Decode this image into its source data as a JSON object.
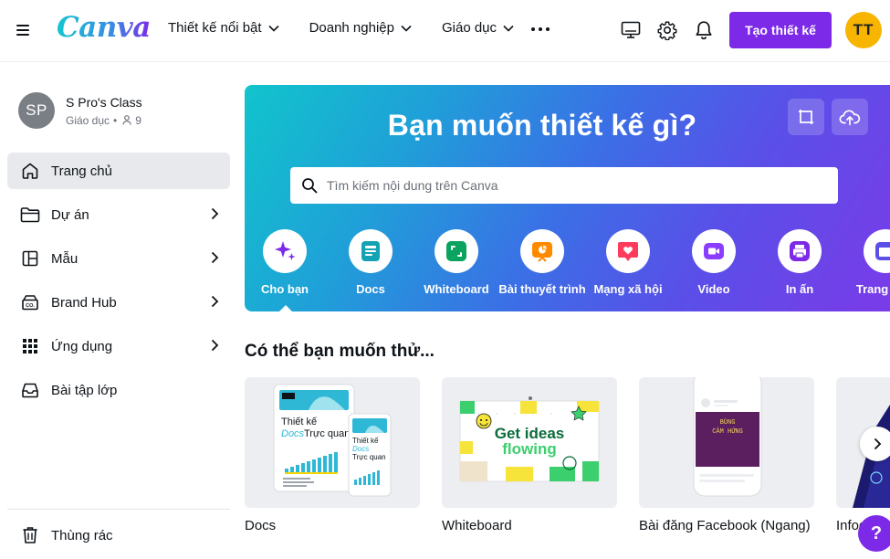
{
  "header": {
    "logo": "Canva",
    "nav": [
      {
        "label": "Thiết kế nổi bật"
      },
      {
        "label": "Doanh nghiệp"
      },
      {
        "label": "Giáo dục"
      }
    ],
    "create_button": "Tạo thiết kế",
    "user_initials": "TT"
  },
  "sidebar": {
    "team_initials": "SP",
    "team_name": "S Pro's Class",
    "team_type": "Giáo dục",
    "team_members": "9",
    "items": [
      {
        "label": "Trang chủ",
        "icon": "home-icon"
      },
      {
        "label": "Dự án",
        "icon": "folder-icon"
      },
      {
        "label": "Mẫu",
        "icon": "template-icon"
      },
      {
        "label": "Brand Hub",
        "icon": "brand-hub-icon"
      },
      {
        "label": "Ứng dụng",
        "icon": "apps-grid-icon"
      },
      {
        "label": "Bài tập lớp",
        "icon": "inbox-icon"
      }
    ],
    "trash": "Thùng rác"
  },
  "hero": {
    "title": "Bạn muốn thiết kế gì?",
    "search_placeholder": "Tìm kiếm nội dung trên Canva",
    "categories": [
      {
        "label": "Cho bạn",
        "color": "#7d2ae8"
      },
      {
        "label": "Docs",
        "color": "#13a3b5"
      },
      {
        "label": "Whiteboard",
        "color": "#0ba360"
      },
      {
        "label": "Bài thuyết trình",
        "color": "#ff8a00"
      },
      {
        "label": "Mạng xã hội",
        "color": "#ff3b5c"
      },
      {
        "label": "Video",
        "color": "#8b3dff"
      },
      {
        "label": "In ấn",
        "color": "#7d2ae8"
      },
      {
        "label": "Trang web",
        "color": "#5a4fe8"
      }
    ]
  },
  "suggestions": {
    "title": "Có thể bạn muốn thử...",
    "cards": [
      {
        "label": "Docs",
        "thumb_line1": "Thiết kế",
        "thumb_line2": "Docs",
        "thumb_line3": "Trực quan"
      },
      {
        "label": "Whiteboard",
        "thumb_line1": "Get ideas",
        "thumb_line2": "flowing"
      },
      {
        "label": "Bài đăng Facebook (Ngang)",
        "thumb_line1": "BÙNG",
        "thumb_line2": "CẢM HỨNG"
      },
      {
        "label": "Infographic"
      }
    ]
  },
  "help_label": "?"
}
